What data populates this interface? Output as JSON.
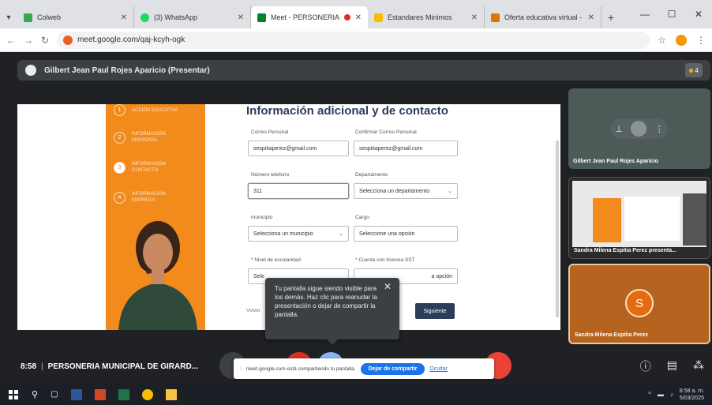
{
  "browser": {
    "tabs": [
      {
        "label": "Colweb",
        "color": "#34a853",
        "active": false
      },
      {
        "label": "(3) WhatsApp",
        "color": "#25d366",
        "active": false
      },
      {
        "label": "Meet - PERSONERIA M",
        "color": "#00832d",
        "active": true
      },
      {
        "label": "Estandares Minimos",
        "color": "#fbbc04",
        "active": false
      },
      {
        "label": "Oferta educativa virtual - Fe",
        "color": "#e37400",
        "active": false
      }
    ],
    "url": "meet.google.com/qaj-kcyh-ogk"
  },
  "meet": {
    "presenter_label": "Gilbert Jean Paul Rojes Aparicio (Presentar)",
    "participants_count": "4",
    "time": "8:58",
    "meeting_title": "PERSONERIA MUNICIPAL DE GIRARD...",
    "tiles": [
      {
        "name": "Gilbert Jean Paul Rojes Aparicio"
      },
      {
        "name": "Sandra Milena Espitia Perez presenta..."
      },
      {
        "name": "Sandra Milena Espitia Perez",
        "initial": "S"
      }
    ],
    "tooltip": "Tu pantalla sigue siendo visible para los demás. Haz clic para reanudar la presentación o dejar de compartir la pantalla.",
    "share_banner": {
      "text": "meet.google.com está compartiendo tu pantalla.",
      "stop_label": "Dejar de compartir",
      "hide_label": "Ocultar"
    }
  },
  "shared_form": {
    "title": "Información adicional y de contacto",
    "steps": [
      {
        "num": "1",
        "label": "Acción educativa"
      },
      {
        "num": "2",
        "label": "Información personal"
      },
      {
        "num": "3",
        "label": "Información contacto"
      },
      {
        "num": "4",
        "label": "Información empresa"
      }
    ],
    "fields": {
      "correo_label": "Correo Personal",
      "correo_value": "sespitiaperez@gmail.com",
      "confirm_label": "Confirmar Correo Personal",
      "confirm_value": "sespitiaperez@gmail.com",
      "telefono_label": "Número telefono",
      "telefono_value": "311",
      "depto_label": "Departamento",
      "depto_value": "Selecciona un departamento",
      "municipio_label": "municipio",
      "municipio_value": "Selecciona un municipio",
      "cargo_label": "Cargo",
      "cargo_value": "Seleccione una opción",
      "escolaridad_label": "* Nivel de escolaridad",
      "escolaridad_value": "Sele",
      "licencia_label": "* Cuenta con licencia SST",
      "licencia_value": "a opción"
    },
    "prev_label": "Volver",
    "next_label": "Siguiente"
  },
  "taskbar": {
    "time": "8:58 a. m.",
    "date": "5/03/2025"
  }
}
